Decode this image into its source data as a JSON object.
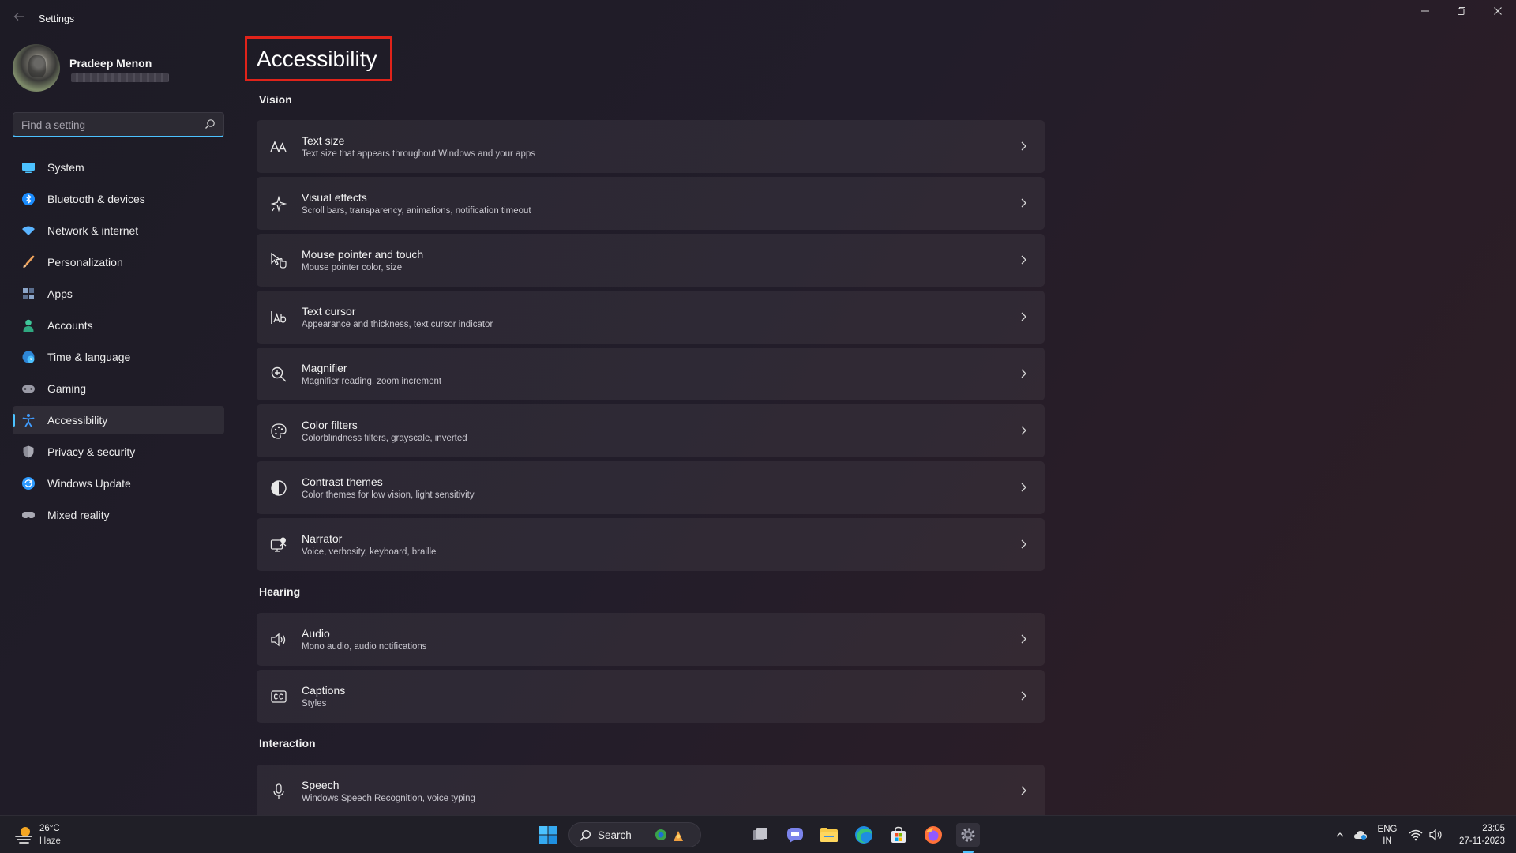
{
  "window": {
    "title": "Settings"
  },
  "profile": {
    "name": "Pradeep Menon"
  },
  "search": {
    "placeholder": "Find a setting"
  },
  "sidebar": {
    "items": [
      {
        "label": "System",
        "icon": "system-icon",
        "color": "#4cc2ff"
      },
      {
        "label": "Bluetooth & devices",
        "icon": "bluetooth-icon",
        "color": "#1a8cff"
      },
      {
        "label": "Network & internet",
        "icon": "wifi-icon",
        "color": "#5ab4ff"
      },
      {
        "label": "Personalization",
        "icon": "brush-icon",
        "color": "#f0a35b"
      },
      {
        "label": "Apps",
        "icon": "apps-icon",
        "color": "#8ca6c9"
      },
      {
        "label": "Accounts",
        "icon": "person-icon",
        "color": "#3fc79a"
      },
      {
        "label": "Time & language",
        "icon": "globe-clock-icon",
        "color": "#4cc2ff"
      },
      {
        "label": "Gaming",
        "icon": "gamepad-icon",
        "color": "#9a9aa6"
      },
      {
        "label": "Accessibility",
        "icon": "accessibility-icon",
        "color": "#3f9cff",
        "active": true
      },
      {
        "label": "Privacy & security",
        "icon": "shield-icon",
        "color": "#a9a9b3"
      },
      {
        "label": "Windows Update",
        "icon": "update-icon",
        "color": "#2e9bff"
      },
      {
        "label": "Mixed reality",
        "icon": "vr-headset-icon",
        "color": "#a9a9b3"
      }
    ]
  },
  "main": {
    "title": "Accessibility",
    "sections": {
      "vision": "Vision",
      "hearing": "Hearing",
      "interaction": "Interaction"
    },
    "items": [
      {
        "title": "Text size",
        "subtitle": "Text size that appears throughout Windows and your apps",
        "icon": "text-size-icon"
      },
      {
        "title": "Visual effects",
        "subtitle": "Scroll bars, transparency, animations, notification timeout",
        "icon": "sparkle-icon"
      },
      {
        "title": "Mouse pointer and touch",
        "subtitle": "Mouse pointer color, size",
        "icon": "pointer-touch-icon"
      },
      {
        "title": "Text cursor",
        "subtitle": "Appearance and thickness, text cursor indicator",
        "icon": "text-cursor-icon"
      },
      {
        "title": "Magnifier",
        "subtitle": "Magnifier reading, zoom increment",
        "icon": "magnifier-icon"
      },
      {
        "title": "Color filters",
        "subtitle": "Colorblindness filters, grayscale, inverted",
        "icon": "palette-icon"
      },
      {
        "title": "Contrast themes",
        "subtitle": "Color themes for low vision, light sensitivity",
        "icon": "contrast-icon"
      },
      {
        "title": "Narrator",
        "subtitle": "Voice, verbosity, keyboard, braille",
        "icon": "narrator-icon"
      },
      {
        "title": "Audio",
        "subtitle": "Mono audio, audio notifications",
        "icon": "speaker-icon"
      },
      {
        "title": "Captions",
        "subtitle": "Styles",
        "icon": "captions-icon"
      },
      {
        "title": "Speech",
        "subtitle": "Windows Speech Recognition, voice typing",
        "icon": "microphone-icon"
      }
    ]
  },
  "taskbar": {
    "weather": {
      "temp": "26°C",
      "desc": "Haze"
    },
    "search_label": "Search",
    "language": {
      "line1": "ENG",
      "line2": "IN"
    },
    "clock": {
      "time": "23:05",
      "date": "27-11-2023"
    }
  },
  "colors": {
    "accent": "#4cc2ff",
    "highlight_border": "#e0231a"
  }
}
